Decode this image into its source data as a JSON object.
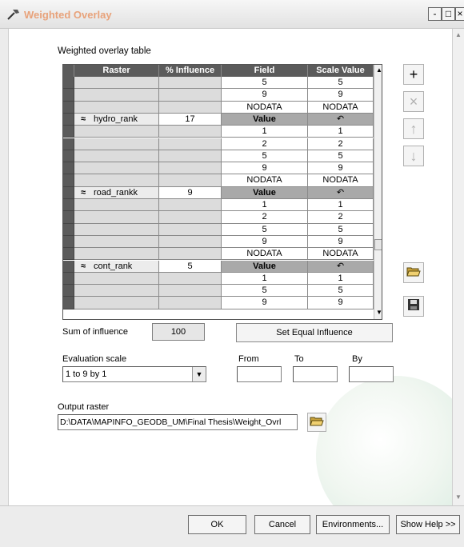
{
  "window": {
    "title": "Weighted Overlay",
    "min": "-",
    "max": "□",
    "close": "×"
  },
  "table": {
    "title": "Weighted overlay table",
    "headers": [
      "Raster",
      "% Influence",
      "Field",
      "Scale Value"
    ],
    "rows": [
      {
        "kind": "val",
        "field": "5",
        "scale": "5"
      },
      {
        "kind": "val",
        "field": "9",
        "scale": "9"
      },
      {
        "kind": "val",
        "field": "NODATA",
        "scale": "NODATA"
      },
      {
        "kind": "hdr",
        "raster": "hydro_rank",
        "influence": "17",
        "field": "Value",
        "scale": "↶"
      },
      {
        "kind": "val",
        "field": "1",
        "scale": "1"
      },
      {
        "kind": "val",
        "field": "2",
        "scale": "2"
      },
      {
        "kind": "val",
        "field": "5",
        "scale": "5"
      },
      {
        "kind": "val",
        "field": "9",
        "scale": "9"
      },
      {
        "kind": "val",
        "field": "NODATA",
        "scale": "NODATA"
      },
      {
        "kind": "hdr",
        "raster": "road_rankk",
        "influence": "9",
        "field": "Value",
        "scale": "↶"
      },
      {
        "kind": "val",
        "field": "1",
        "scale": "1"
      },
      {
        "kind": "val",
        "field": "2",
        "scale": "2"
      },
      {
        "kind": "val",
        "field": "5",
        "scale": "5"
      },
      {
        "kind": "val",
        "field": "9",
        "scale": "9"
      },
      {
        "kind": "val",
        "field": "NODATA",
        "scale": "NODATA"
      },
      {
        "kind": "hdr",
        "raster": "cont_rank",
        "influence": "5",
        "field": "Value",
        "scale": "↶"
      },
      {
        "kind": "val",
        "field": "1",
        "scale": "1"
      },
      {
        "kind": "val",
        "field": "5",
        "scale": "5"
      },
      {
        "kind": "val",
        "field": "9",
        "scale": "9"
      }
    ]
  },
  "side_buttons": {
    "add": "+",
    "remove": "×",
    "up": "↑",
    "down": "↓"
  },
  "influence": {
    "label": "Sum of influence",
    "value": "100",
    "equal_button": "Set Equal Influence"
  },
  "evaluation": {
    "label": "Evaluation scale",
    "value": "1 to 9 by 1",
    "from_label": "From",
    "to_label": "To",
    "by_label": "By"
  },
  "output": {
    "label": "Output raster",
    "path": "D:\\DATA\\MAPINFO_GEODB_UM\\Final Thesis\\Weight_Ovrl"
  },
  "buttons": {
    "ok": "OK",
    "cancel": "Cancel",
    "environments": "Environments...",
    "show_help": "Show Help >>"
  }
}
